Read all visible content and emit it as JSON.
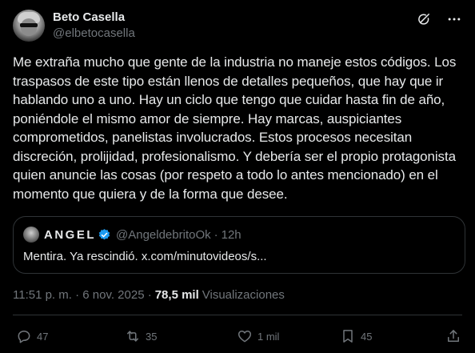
{
  "author": {
    "display_name": "Beto Casella",
    "handle": "@elbetocasella"
  },
  "body_text": "Me extraña mucho que gente de la industria no maneje estos códigos. Los traspasos de este tipo están llenos de detalles pequeños, que hay que ir hablando uno a uno. Hay un ciclo que tengo que cuidar hasta fin de año, poniéndole el mismo amor de siempre. Hay marcas, auspiciantes comprometidos, panelistas involucrados. Estos procesos necesitan discreción, prolijidad, profesionalismo. Y debería ser el propio protagonista quien anuncie las cosas (por respeto a todo lo antes mencionado) en el momento que quiera y de la forma que desee.",
  "quote": {
    "display_name": "ANGEL",
    "handle": "@AngeldebritoOk",
    "separator": "·",
    "time": "12h",
    "text": "Mentira. Ya rescindió. x.com/minutovideos/s..."
  },
  "meta": {
    "timestamp": "11:51 p. m. · 6 nov. 2025 ·",
    "views_count": "78,5 mil",
    "views_label": "Visualizaciones"
  },
  "actions": {
    "replies": "47",
    "reposts": "35",
    "likes": "1 mil",
    "bookmarks": "45"
  },
  "colors": {
    "background": "#000000",
    "text": "#e7e9ea",
    "secondary": "#71767b",
    "border": "#2f3336",
    "verified": "#1d9bf0"
  },
  "icons": [
    "grok-icon",
    "more-icon",
    "verified-icon",
    "reply-icon",
    "repost-icon",
    "like-icon",
    "bookmark-icon",
    "share-icon"
  ]
}
